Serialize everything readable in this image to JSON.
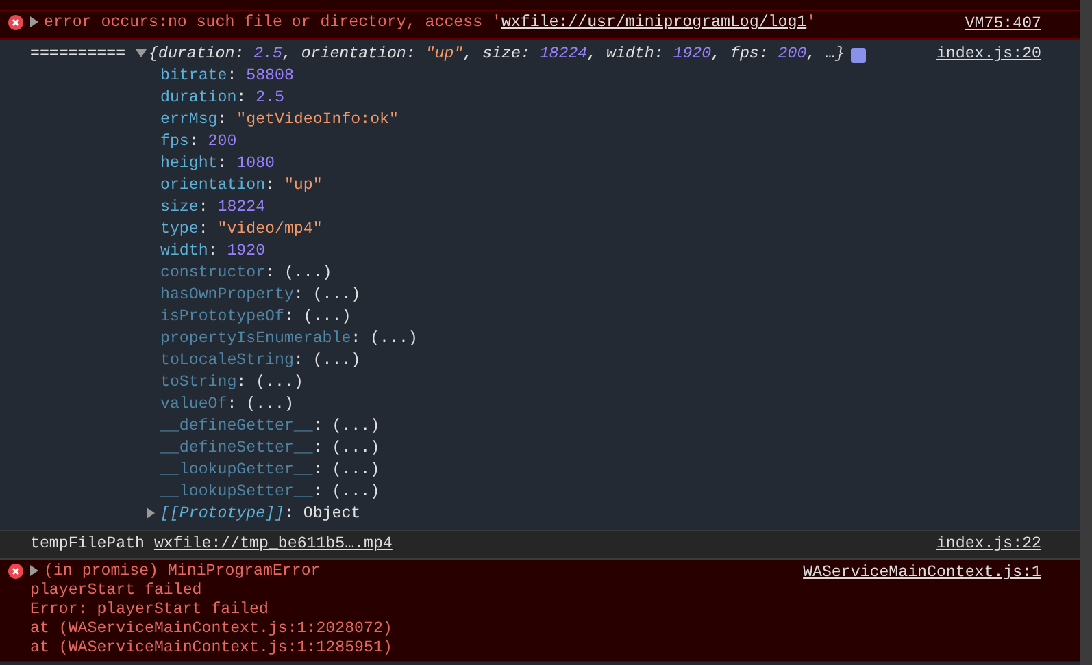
{
  "messages": [
    {
      "kind": "error",
      "expanded": false,
      "parts": [
        {
          "text": "error occurs:no such file or directory, access '",
          "kind": "text"
        },
        {
          "text": "wxfile://usr/miniprogramLog/log1",
          "kind": "link"
        },
        {
          "text": "'",
          "kind": "text"
        }
      ],
      "source": "VM75:407"
    },
    {
      "kind": "object",
      "prefix": "==========",
      "expanded": true,
      "summary": [
        {
          "text": "{duration: ",
          "kind": "plain"
        },
        {
          "text": "2.5",
          "kind": "number"
        },
        {
          "text": ", orientation: ",
          "kind": "plain"
        },
        {
          "text": "\"up\"",
          "kind": "string"
        },
        {
          "text": ", size: ",
          "kind": "plain"
        },
        {
          "text": "18224",
          "kind": "number"
        },
        {
          "text": ", width: ",
          "kind": "plain"
        },
        {
          "text": "1920",
          "kind": "number"
        },
        {
          "text": ", fps: ",
          "kind": "plain"
        },
        {
          "text": "200",
          "kind": "number"
        },
        {
          "text": ", …}",
          "kind": "plain"
        }
      ],
      "source": "index.js:20",
      "separator": ": ",
      "properties": [
        {
          "name": "bitrate",
          "value": "58808",
          "kind": "number",
          "own": true
        },
        {
          "name": "duration",
          "value": "2.5",
          "kind": "number",
          "own": true
        },
        {
          "name": "errMsg",
          "value": "\"getVideoInfo:ok\"",
          "kind": "string",
          "own": true
        },
        {
          "name": "fps",
          "value": "200",
          "kind": "number",
          "own": true
        },
        {
          "name": "height",
          "value": "1080",
          "kind": "number",
          "own": true
        },
        {
          "name": "orientation",
          "value": "\"up\"",
          "kind": "string",
          "own": true
        },
        {
          "name": "size",
          "value": "18224",
          "kind": "number",
          "own": true
        },
        {
          "name": "type",
          "value": "\"video/mp4\"",
          "kind": "string",
          "own": true
        },
        {
          "name": "width",
          "value": "1920",
          "kind": "number",
          "own": true
        },
        {
          "name": "constructor",
          "value": "(...)",
          "kind": "plain",
          "own": false
        },
        {
          "name": "hasOwnProperty",
          "value": "(...)",
          "kind": "plain",
          "own": false
        },
        {
          "name": "isPrototypeOf",
          "value": "(...)",
          "kind": "plain",
          "own": false
        },
        {
          "name": "propertyIsEnumerable",
          "value": "(...)",
          "kind": "plain",
          "own": false
        },
        {
          "name": "toLocaleString",
          "value": "(...)",
          "kind": "plain",
          "own": false
        },
        {
          "name": "toString",
          "value": "(...)",
          "kind": "plain",
          "own": false
        },
        {
          "name": "valueOf",
          "value": "(...)",
          "kind": "plain",
          "own": false
        },
        {
          "name": "__defineGetter__",
          "value": "(...)",
          "kind": "plain",
          "own": false
        },
        {
          "name": "__defineSetter__",
          "value": "(...)",
          "kind": "plain",
          "own": false
        },
        {
          "name": "__lookupGetter__",
          "value": "(...)",
          "kind": "plain",
          "own": false
        },
        {
          "name": "__lookupSetter__",
          "value": "(...)",
          "kind": "plain",
          "own": false
        }
      ],
      "prototype": {
        "name": "[[Prototype]]",
        "value": "Object",
        "expanded": false
      }
    },
    {
      "kind": "log",
      "parts": [
        {
          "text": "tempFilePath ",
          "kind": "text"
        },
        {
          "text": "wxfile://tmp_be611b5….mp4",
          "kind": "link"
        }
      ],
      "source": "index.js:22"
    },
    {
      "kind": "error",
      "expanded": false,
      "parts": [
        {
          "text": "(in promise) MiniProgramError",
          "kind": "text"
        }
      ],
      "lines": [
        "playerStart failed",
        "Error: playerStart failed",
        "at (WAServiceMainContext.js:1:2028072)",
        "at (WAServiceMainContext.js:1:1285951)"
      ],
      "source": "WAServiceMainContext.js:1"
    }
  ]
}
